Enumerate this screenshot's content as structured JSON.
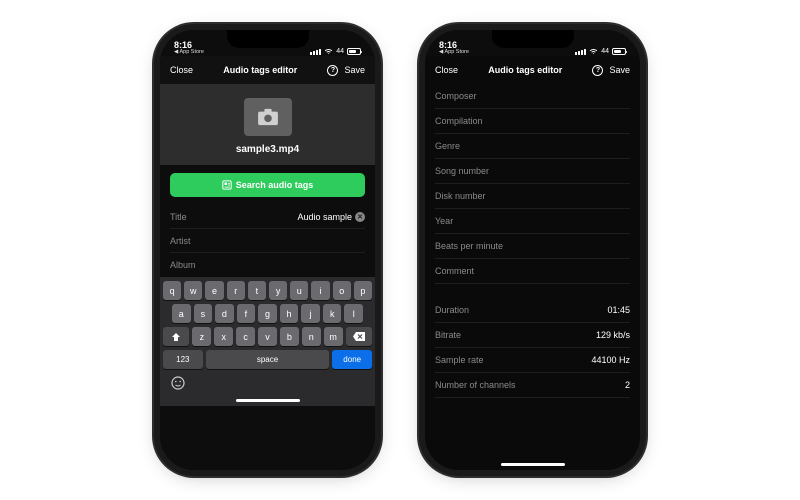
{
  "statusbar": {
    "time": "8:16",
    "back_crumb": "App Store",
    "battery": "44"
  },
  "navbar": {
    "close": "Close",
    "title": "Audio tags editor",
    "save": "Save"
  },
  "phone1": {
    "filename": "sample3.mp4",
    "search_btn": "Search audio tags",
    "fields": {
      "title_label": "Title",
      "title_value": "Audio sample",
      "artist_label": "Artist",
      "album_label": "Album"
    },
    "keyboard": {
      "num_key": "123",
      "space": "space",
      "done": "done"
    }
  },
  "phone2": {
    "fields": [
      {
        "label": "Composer",
        "value": ""
      },
      {
        "label": "Compilation",
        "value": ""
      },
      {
        "label": "Genre",
        "value": ""
      },
      {
        "label": "Song number",
        "value": ""
      },
      {
        "label": "Disk number",
        "value": ""
      },
      {
        "label": "Year",
        "value": ""
      },
      {
        "label": "Beats per minute",
        "value": ""
      },
      {
        "label": "Comment",
        "value": ""
      }
    ],
    "readonly": [
      {
        "label": "Duration",
        "value": "01:45"
      },
      {
        "label": "Bitrate",
        "value": "129 kb/s"
      },
      {
        "label": "Sample rate",
        "value": "44100 Hz"
      },
      {
        "label": "Number of channels",
        "value": "2"
      }
    ]
  }
}
